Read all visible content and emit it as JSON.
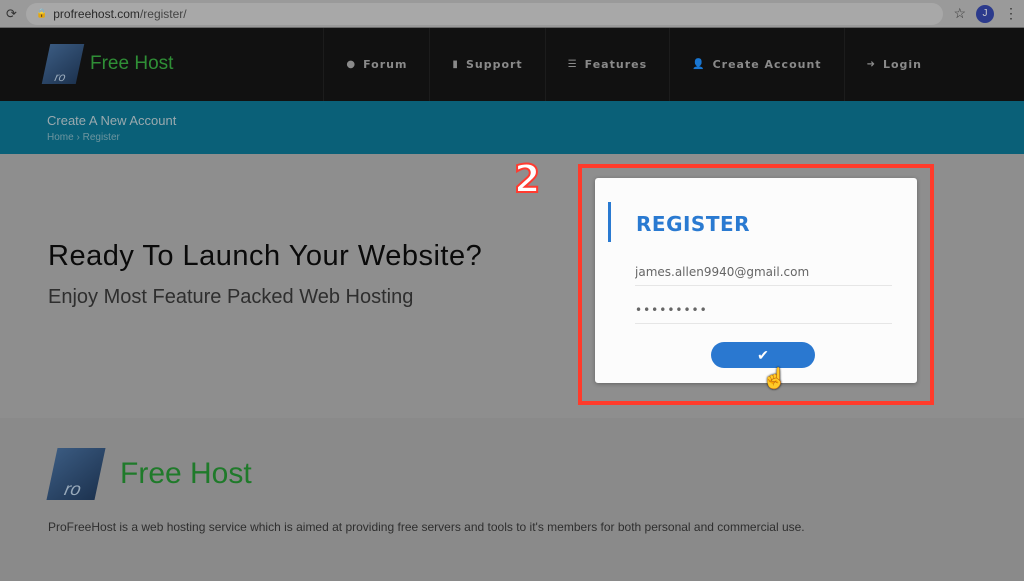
{
  "browser": {
    "url_host": "profreehost.com",
    "url_path": "/register/",
    "avatar": "J"
  },
  "nav": {
    "logo_text": "Free Host",
    "logo_mark": "ro",
    "items": [
      {
        "label": "Forum",
        "icon": "comments-icon"
      },
      {
        "label": "Support",
        "icon": "book-icon"
      },
      {
        "label": "Features",
        "icon": "list-icon"
      },
      {
        "label": "Create Account",
        "icon": "user-plus-icon"
      },
      {
        "label": "Login",
        "icon": "sign-in-icon"
      }
    ]
  },
  "banner": {
    "title": "Create A New Account",
    "crumbs": [
      "Home",
      "Register"
    ]
  },
  "hero": {
    "heading": "Ready To Launch Your Website?",
    "subheading": "Enjoy Most Feature Packed Web Hosting",
    "step": "2"
  },
  "register": {
    "title": "REGISTER",
    "email": "james.allen9940@gmail.com",
    "password": "•••••••••",
    "submit_icon": "check-icon"
  },
  "footer": {
    "logo_text": "Free Host",
    "logo_mark": "ro",
    "description": "ProFreeHost is a web hosting service which is aimed at providing free servers and tools to it's members for both personal and commercial use."
  },
  "colors": {
    "accent": "#2a7ad1",
    "highlight": "#ff3b2b",
    "banner": "#0a6078",
    "brand_green": "#2f8f36"
  }
}
